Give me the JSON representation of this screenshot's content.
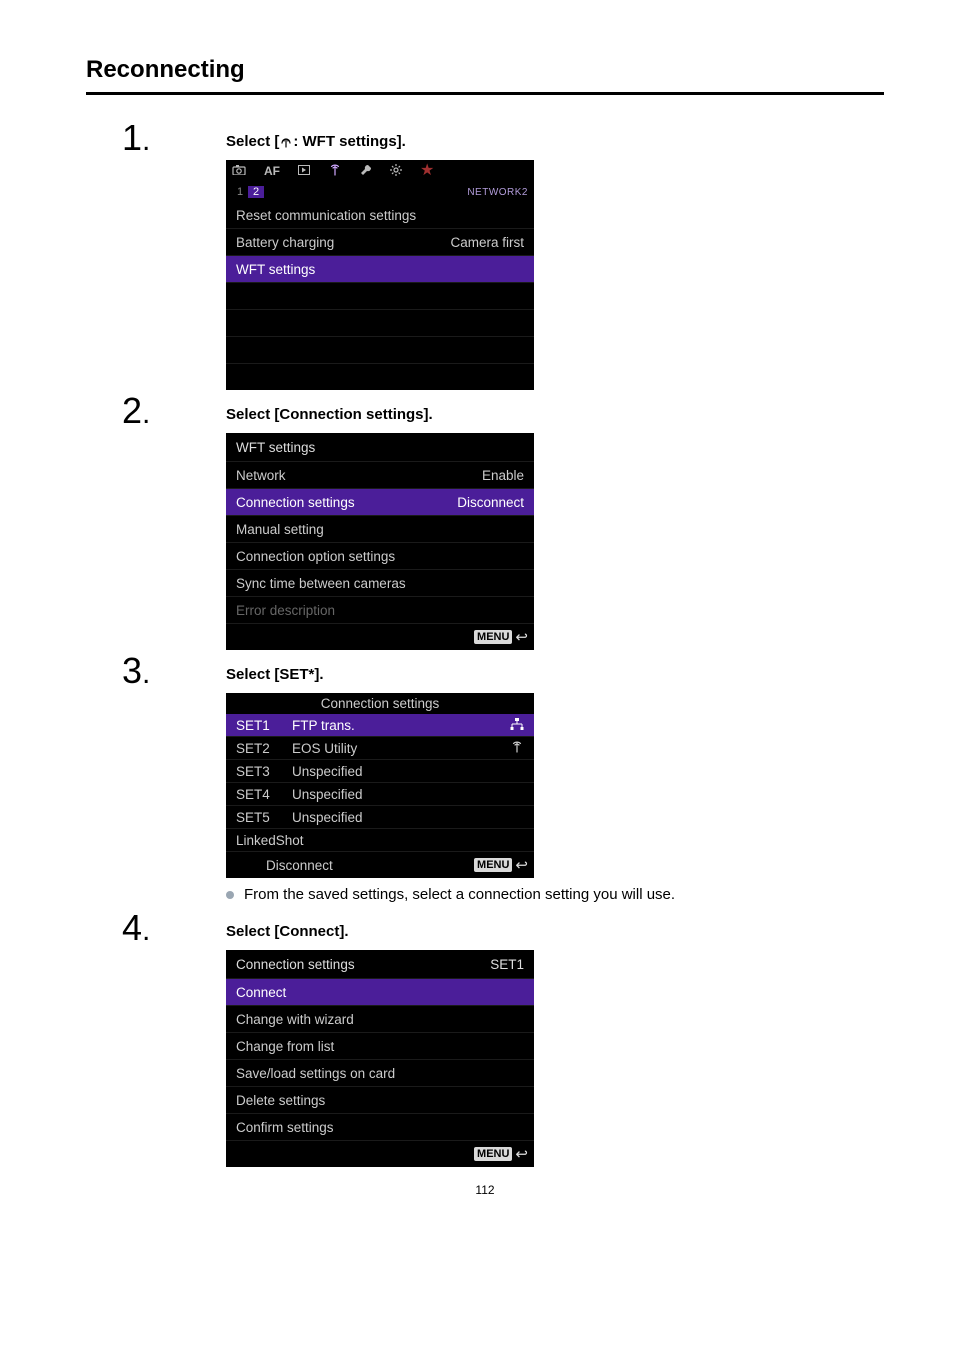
{
  "title": "Reconnecting",
  "page_number": "112",
  "steps": {
    "s1": {
      "num": "1",
      "instruction_prefix": "Select [",
      "instruction_suffix": ": WFT settings].",
      "tabs_icons": [
        "camera",
        "AF",
        "play",
        "antenna",
        "wrench",
        "cog",
        "star"
      ],
      "tab_text_AF": "AF",
      "sub_nums": [
        "1",
        "2"
      ],
      "sub_label": "NETWORK2",
      "rows": [
        {
          "left": "Reset communication settings",
          "right": ""
        },
        {
          "left": "Battery charging",
          "right": "Camera first"
        },
        {
          "left": "WFT settings",
          "right": "",
          "hl": true
        }
      ]
    },
    "s2": {
      "num": "2",
      "instruction": "Select [Connection settings].",
      "header": "WFT settings",
      "rows": [
        {
          "left": "Network",
          "right": "Enable"
        },
        {
          "left": "Connection settings",
          "right": "Disconnect",
          "hl": true
        },
        {
          "left": "Manual setting",
          "right": ""
        },
        {
          "left": "Connection option settings",
          "right": ""
        },
        {
          "left": "Sync time between cameras",
          "right": ""
        },
        {
          "left": "Error description",
          "right": "",
          "dim": true
        }
      ],
      "menu_label": "MENU"
    },
    "s3": {
      "num": "3",
      "instruction": "Select [SET*].",
      "header": "Connection settings",
      "rows": [
        {
          "lab": "SET1",
          "val": "FTP trans.",
          "icon": "lan",
          "sel": true
        },
        {
          "lab": "SET2",
          "val": "EOS Utility",
          "icon": "antenna"
        },
        {
          "lab": "SET3",
          "val": "Unspecified",
          "icon": ""
        },
        {
          "lab": "SET4",
          "val": "Unspecified",
          "icon": ""
        },
        {
          "lab": "SET5",
          "val": "Unspecified",
          "icon": ""
        },
        {
          "lab": "LinkedShot",
          "val": "",
          "icon": "",
          "full": true
        }
      ],
      "footer_left": "Disconnect",
      "menu_label": "MENU",
      "note": "From the saved settings, select a connection setting you will use."
    },
    "s4": {
      "num": "4",
      "instruction": "Select [Connect].",
      "header_left": "Connection settings",
      "header_right": "SET1",
      "rows": [
        {
          "left": "Connect",
          "hl": true
        },
        {
          "left": "Change with wizard"
        },
        {
          "left": "Change from list"
        },
        {
          "left": "Save/load settings on card"
        },
        {
          "left": "Delete settings"
        },
        {
          "left": "Confirm settings"
        }
      ],
      "menu_label": "MENU"
    }
  }
}
